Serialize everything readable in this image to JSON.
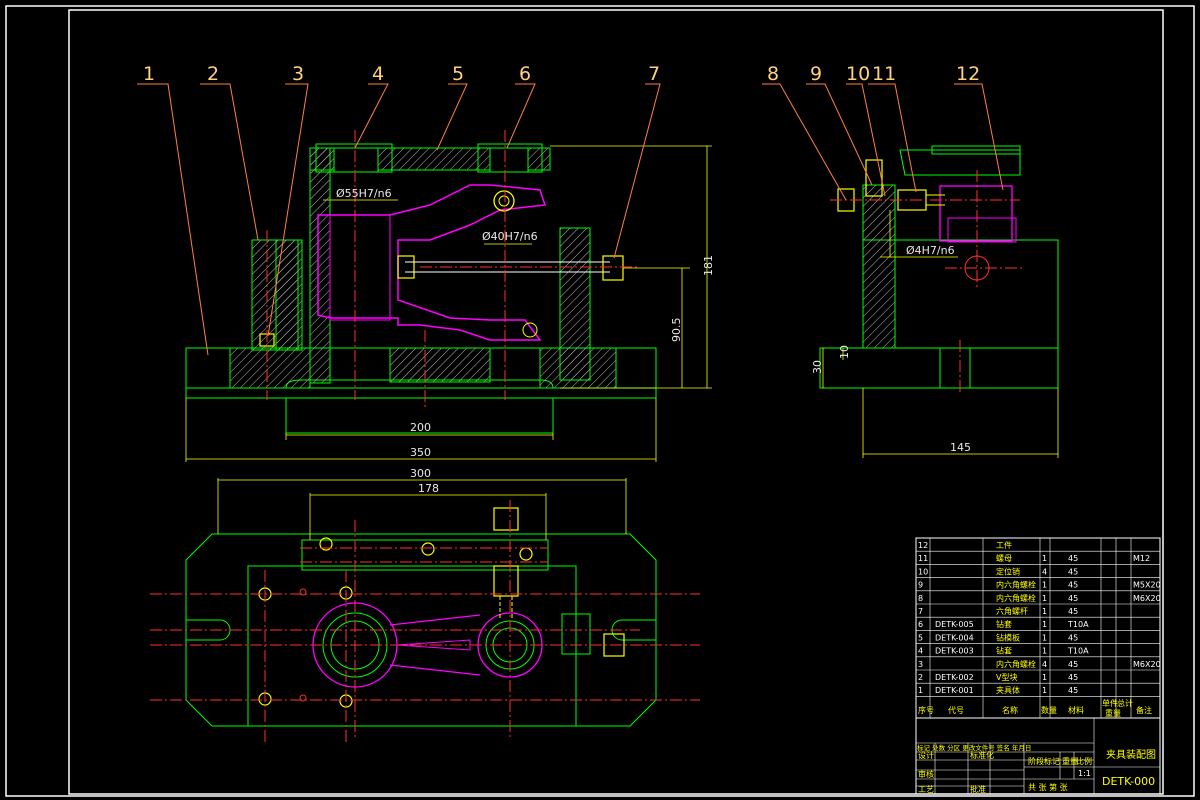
{
  "callouts": [
    "1",
    "2",
    "3",
    "4",
    "5",
    "6",
    "7",
    "8",
    "9",
    "10",
    "11",
    "12"
  ],
  "dimensions": {
    "fit_55": "Ø55H7/n6",
    "fit_40": "Ø40H7/n6",
    "fit_4": "Ø4H7/n6",
    "height_181": "181",
    "height_90_5": "90.5",
    "width_200": "200",
    "width_350": "350",
    "width_300": "300",
    "width_178": "178",
    "width_145": "145",
    "height_30": "30",
    "height_10": "10"
  },
  "bom": [
    {
      "no": "12",
      "code": "",
      "name": "工件",
      "qty": "",
      "material": "",
      "note": ""
    },
    {
      "no": "11",
      "code": "",
      "name": "螺母",
      "qty": "1",
      "material": "45",
      "note": "M12"
    },
    {
      "no": "10",
      "code": "",
      "name": "定位销",
      "qty": "4",
      "material": "45",
      "note": ""
    },
    {
      "no": "9",
      "code": "",
      "name": "内六角螺栓",
      "qty": "1",
      "material": "45",
      "note": "M5X20"
    },
    {
      "no": "8",
      "code": "",
      "name": "内六角螺栓",
      "qty": "1",
      "material": "45",
      "note": "M6X20"
    },
    {
      "no": "7",
      "code": "",
      "name": "六角螺杆",
      "qty": "1",
      "material": "45",
      "note": ""
    },
    {
      "no": "6",
      "code": "DETK-005",
      "name": "钻套",
      "qty": "1",
      "material": "T10A",
      "note": ""
    },
    {
      "no": "5",
      "code": "DETK-004",
      "name": "钻模板",
      "qty": "1",
      "material": "45",
      "note": ""
    },
    {
      "no": "4",
      "code": "DETK-003",
      "name": "钻套",
      "qty": "1",
      "material": "T10A",
      "note": ""
    },
    {
      "no": "3",
      "code": "",
      "name": "内六角螺栓",
      "qty": "4",
      "material": "45",
      "note": "M6X20"
    },
    {
      "no": "2",
      "code": "DETK-002",
      "name": "V型块",
      "qty": "1",
      "material": "45",
      "note": ""
    },
    {
      "no": "1",
      "code": "DETK-001",
      "name": "夹具体",
      "qty": "1",
      "material": "45",
      "note": ""
    }
  ],
  "bom_header": {
    "no": "序号",
    "code": "代号",
    "name": "名称",
    "qty": "数量",
    "material": "材料",
    "unit_weight": "单件",
    "total_weight": "总计",
    "weight": "重量",
    "note": "备注"
  },
  "title_block": {
    "drawing_title": "夹具装配图",
    "drawing_number": "DETK-000",
    "scale": "1:1",
    "scale_label": "比例",
    "weight_label": "重量",
    "stage_label": "阶段标记",
    "sheets_label": "共 张 第 张",
    "revision_row": "标记 处数 分区 更改文件号 签名 年月日",
    "designer_label": "设计",
    "standardize_label": "标准化",
    "review_label": "审核",
    "process_label": "工艺",
    "approve_label": "批准"
  },
  "colors": {
    "background": "#000000",
    "outline": "#00ff00",
    "border": "#ffffff",
    "callout_leader": "#ff7f3f",
    "callout_number": "#ffd27f",
    "centerline": "#ff3030",
    "part_magenta": "#ff00ff",
    "hatch": "#c0c0c0",
    "fastener": "#ffff00",
    "title_text": "#ffff00"
  }
}
